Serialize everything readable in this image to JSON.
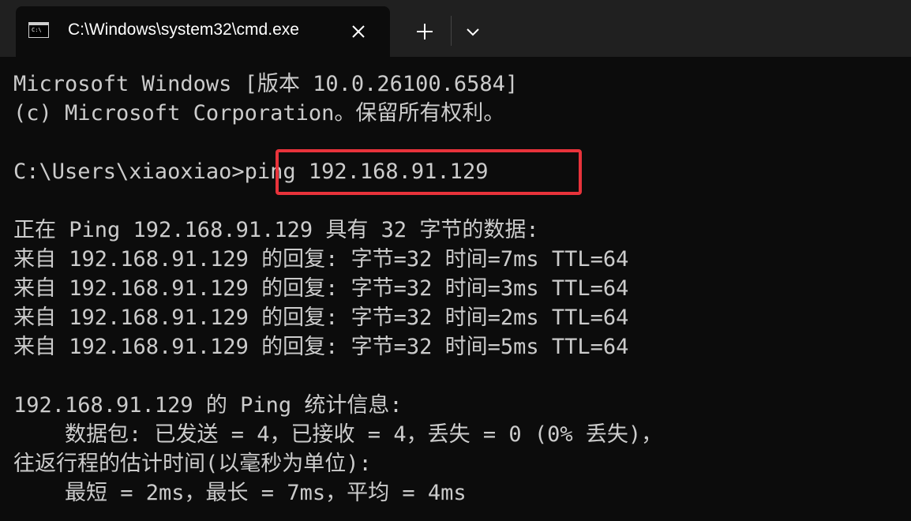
{
  "window": {
    "tab_title": "C:\\Windows\\system32\\cmd.exe",
    "icons": {
      "tab_icon": "console-icon",
      "close": "close-icon",
      "new_tab": "plus-icon",
      "dropdown": "chevron-down-icon"
    },
    "colors": {
      "titlebar": "#202020",
      "console_bg": "#0c0c0c",
      "text": "#cccccc",
      "highlight": "#e8333b"
    }
  },
  "console": {
    "lines": [
      "Microsoft Windows [版本 10.0.26100.6584]",
      "(c) Microsoft Corporation。保留所有权利。",
      "",
      "C:\\Users\\xiaoxiao>ping 192.168.91.129",
      "",
      "正在 Ping 192.168.91.129 具有 32 字节的数据:",
      "来自 192.168.91.129 的回复: 字节=32 时间=7ms TTL=64",
      "来自 192.168.91.129 的回复: 字节=32 时间=3ms TTL=64",
      "来自 192.168.91.129 的回复: 字节=32 时间=2ms TTL=64",
      "来自 192.168.91.129 的回复: 字节=32 时间=5ms TTL=64",
      "",
      "192.168.91.129 的 Ping 统计信息:",
      "    数据包: 已发送 = 4，已接收 = 4，丢失 = 0 (0% 丢失)，",
      "往返行程的估计时间(以毫秒为单位):",
      "    最短 = 2ms，最长 = 7ms，平均 = 4ms"
    ],
    "highlighted_command": "ping 192.168.91.129"
  }
}
